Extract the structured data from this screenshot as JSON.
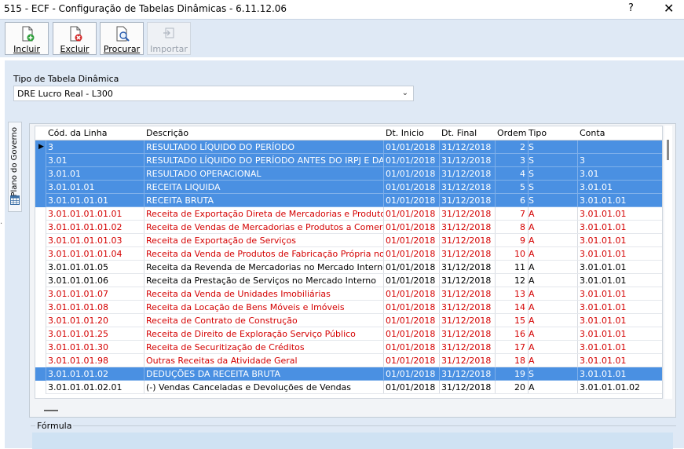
{
  "window": {
    "title": "515 - ECF - Configuração de Tabelas Dinâmicas - 6.11.12.06",
    "help": "?",
    "close": "✕"
  },
  "toolbar": {
    "incluir": "Incluir",
    "excluir": "Excluir",
    "procurar": "Procurar",
    "importar": "Importar"
  },
  "form": {
    "tipo_label": "Tipo de Tabela Dinâmica",
    "tipo_value": "DRE Lucro Real - L300"
  },
  "sidetab": {
    "label": "Plano do Governo"
  },
  "grid": {
    "columns": [
      "Cód. da Linha",
      "Descrição",
      "Dt. Inicio",
      "Dt. Final",
      "Ordem",
      "Tipo",
      "Conta"
    ],
    "rows": [
      {
        "cod": "3",
        "desc": "RESULTADO LÍQUIDO DO PERÍODO",
        "ini": "01/01/2018",
        "fim": "31/12/2018",
        "ordem": "2",
        "tipo": "S",
        "conta": "",
        "style": "sel"
      },
      {
        "cod": "3.01",
        "desc": "RESULTADO LÍQUIDO DO PERÍODO ANTES DO IRPJ E DA CSLL",
        "ini": "01/01/2018",
        "fim": "31/12/2018",
        "ordem": "3",
        "tipo": "S",
        "conta": "3",
        "style": "sel"
      },
      {
        "cod": "3.01.01",
        "desc": "RESULTADO OPERACIONAL",
        "ini": "01/01/2018",
        "fim": "31/12/2018",
        "ordem": "4",
        "tipo": "S",
        "conta": "3.01",
        "style": "sel"
      },
      {
        "cod": "3.01.01.01",
        "desc": "RECEITA LIQUIDA",
        "ini": "01/01/2018",
        "fim": "31/12/2018",
        "ordem": "5",
        "tipo": "S",
        "conta": "3.01.01",
        "style": "sel"
      },
      {
        "cod": "3.01.01.01.01",
        "desc": "RECEITA BRUTA",
        "ini": "01/01/2018",
        "fim": "31/12/2018",
        "ordem": "6",
        "tipo": "S",
        "conta": "3.01.01.01",
        "style": "sel"
      },
      {
        "cod": "3.01.01.01.01.01",
        "desc": "Receita de Exportação Direta de Mercadorias e Produtos",
        "ini": "01/01/2018",
        "fim": "31/12/2018",
        "ordem": "7",
        "tipo": "A",
        "conta": "3.01.01.01",
        "style": "red"
      },
      {
        "cod": "3.01.01.01.01.02",
        "desc": "Receita de Vendas de Mercadorias e Produtos a Comercial Exportadora",
        "ini": "01/01/2018",
        "fim": "31/12/2018",
        "ordem": "8",
        "tipo": "A",
        "conta": "3.01.01.01",
        "style": "red"
      },
      {
        "cod": "3.01.01.01.01.03",
        "desc": "Receita de Exportação de Serviços",
        "ini": "01/01/2018",
        "fim": "31/12/2018",
        "ordem": "9",
        "tipo": "A",
        "conta": "3.01.01.01",
        "style": "red"
      },
      {
        "cod": "3.01.01.01.01.04",
        "desc": "Receita da Venda de Produtos de Fabricação Própria no Mercado Interno",
        "ini": "01/01/2018",
        "fim": "31/12/2018",
        "ordem": "10",
        "tipo": "A",
        "conta": "3.01.01.01",
        "style": "red"
      },
      {
        "cod": "3.01.01.01.05",
        "desc": "Receita da Revenda de Mercadorias no Mercado Interno",
        "ini": "01/01/2018",
        "fim": "31/12/2018",
        "ordem": "11",
        "tipo": "A",
        "conta": "3.01.01.01",
        "style": "black"
      },
      {
        "cod": "3.01.01.01.06",
        "desc": "Receita da Prestação de Serviços no Mercado Interno",
        "ini": "01/01/2018",
        "fim": "31/12/2018",
        "ordem": "12",
        "tipo": "A",
        "conta": "3.01.01.01",
        "style": "black"
      },
      {
        "cod": "3.01.01.01.07",
        "desc": "Receita da Venda de Unidades Imobiliárias",
        "ini": "01/01/2018",
        "fim": "31/12/2018",
        "ordem": "13",
        "tipo": "A",
        "conta": "3.01.01.01",
        "style": "red"
      },
      {
        "cod": "3.01.01.01.08",
        "desc": "Receita da Locação de Bens Móveis e Imóveis",
        "ini": "01/01/2018",
        "fim": "31/12/2018",
        "ordem": "14",
        "tipo": "A",
        "conta": "3.01.01.01",
        "style": "red"
      },
      {
        "cod": "3.01.01.01.20",
        "desc": "Receita de Contrato de Construção",
        "ini": "01/01/2018",
        "fim": "31/12/2018",
        "ordem": "15",
        "tipo": "A",
        "conta": "3.01.01.01",
        "style": "red"
      },
      {
        "cod": "3.01.01.01.25",
        "desc": "Receita de Direito de Exploração Serviço Público",
        "ini": "01/01/2018",
        "fim": "31/12/2018",
        "ordem": "16",
        "tipo": "A",
        "conta": "3.01.01.01",
        "style": "red"
      },
      {
        "cod": "3.01.01.01.30",
        "desc": "Receita de Securitização de Créditos",
        "ini": "01/01/2018",
        "fim": "31/12/2018",
        "ordem": "17",
        "tipo": "A",
        "conta": "3.01.01.01",
        "style": "red"
      },
      {
        "cod": "3.01.01.01.98",
        "desc": "Outras Receitas da Atividade Geral",
        "ini": "01/01/2018",
        "fim": "31/12/2018",
        "ordem": "18",
        "tipo": "A",
        "conta": "3.01.01.01",
        "style": "red"
      },
      {
        "cod": "3.01.01.01.02",
        "desc": "DEDUÇÕES DA RECEITA BRUTA",
        "ini": "01/01/2018",
        "fim": "31/12/2018",
        "ordem": "19",
        "tipo": "S",
        "conta": "3.01.01.01",
        "style": "sel"
      },
      {
        "cod": "3.01.01.01.02.01",
        "desc": "(-) Vendas Canceladas e Devoluções de Vendas",
        "ini": "01/01/2018",
        "fim": "31/12/2018",
        "ordem": "20",
        "tipo": "A",
        "conta": "3.01.01.01.02",
        "style": "black"
      }
    ]
  },
  "formula": {
    "label": "Fórmula"
  },
  "colors": {
    "selected_row": "#4a90e2",
    "red_text": "#d40000",
    "toolbar_bg": "#dfe9f5"
  }
}
